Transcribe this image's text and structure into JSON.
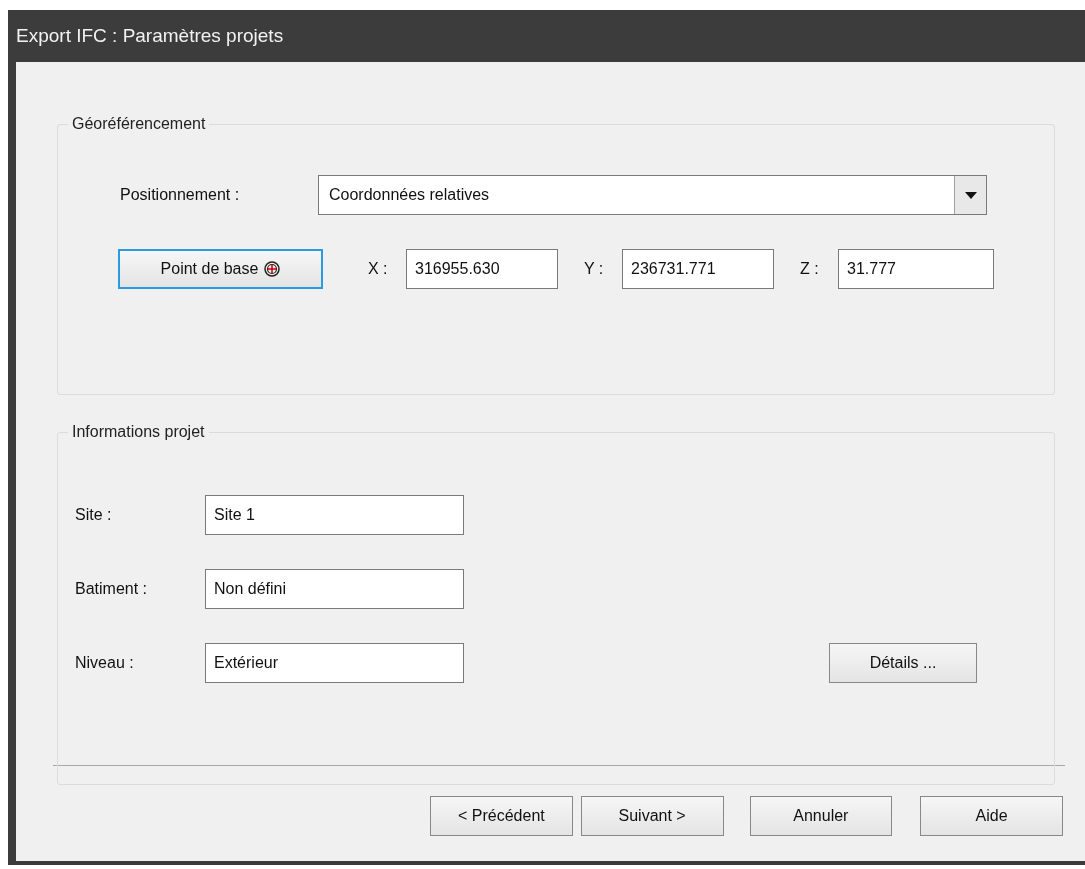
{
  "window": {
    "title": "Export IFC : Paramètres projets"
  },
  "georeferencing": {
    "title": "Géoréférencement",
    "positioning": {
      "label": "Positionnement :",
      "value": "Coordonnées relatives"
    },
    "base_point_button": {
      "label": "Point de base",
      "focused": true
    },
    "coordinates": [
      {
        "label": "X :",
        "value": "316955.630"
      },
      {
        "label": "Y :",
        "value": "236731.771"
      },
      {
        "label": "Z :",
        "value": "31.777"
      }
    ]
  },
  "project_info": {
    "title": "Informations projet",
    "fields": [
      {
        "label": "Site :",
        "value": "Site 1"
      },
      {
        "label": "Batiment :",
        "value": "Non défini"
      },
      {
        "label": "Niveau :",
        "value": "Extérieur"
      }
    ],
    "details_button": "Détails ..."
  },
  "buttons": [
    "< Précédent",
    "Suivant >",
    "Annuler",
    "Aide"
  ]
}
